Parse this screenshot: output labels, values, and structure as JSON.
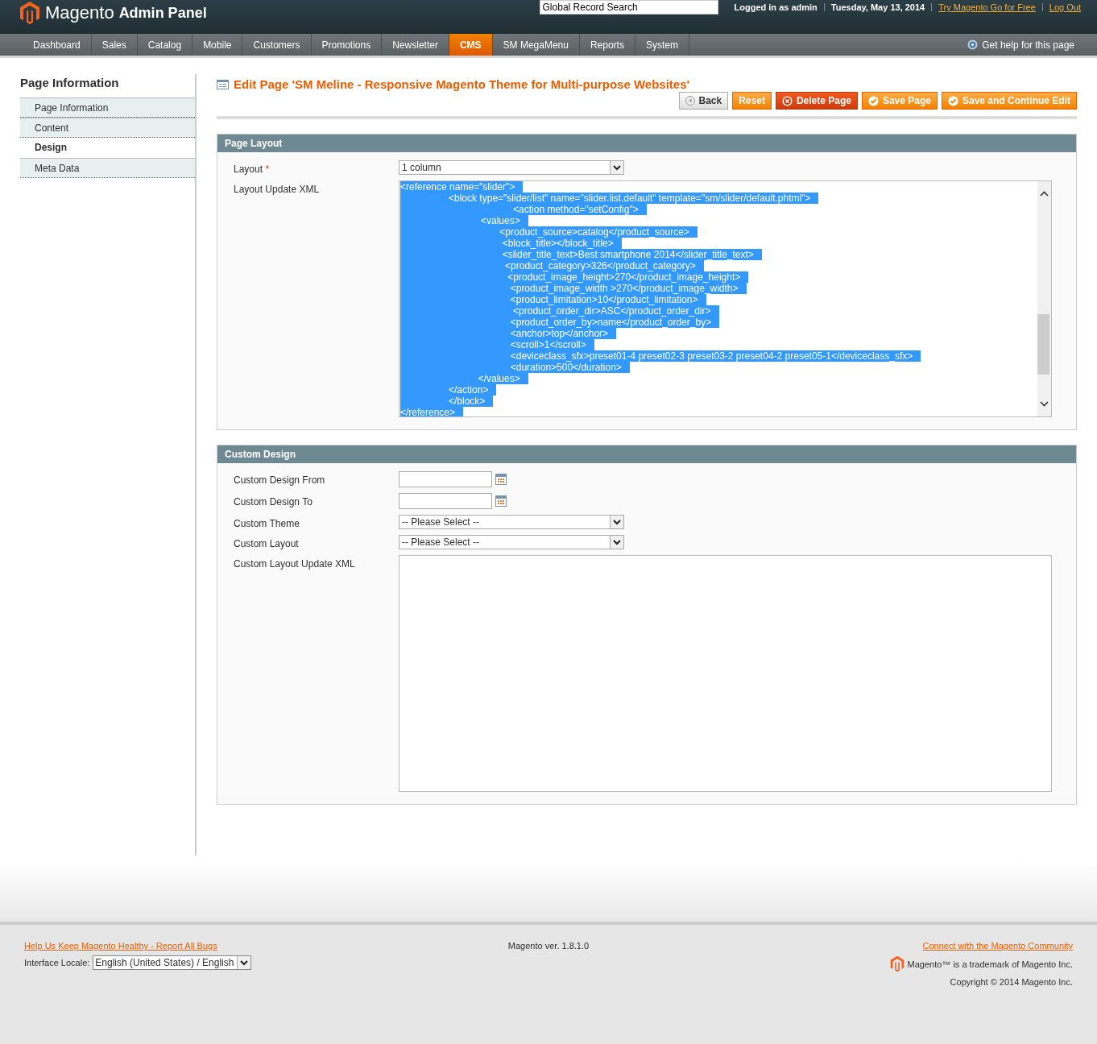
{
  "header": {
    "logo": "Magento",
    "logo_suffix": "Admin Panel",
    "search": {
      "value": "Global Record Search"
    },
    "user": "Logged in as admin",
    "date": "Tuesday, May 13, 2014",
    "links": [
      "Try Magento Go for Free",
      "Log Out"
    ]
  },
  "nav": {
    "items": [
      {
        "label": "Dashboard",
        "selected": false
      },
      {
        "label": "Sales",
        "selected": false
      },
      {
        "label": "Catalog",
        "selected": false
      },
      {
        "label": "Mobile",
        "selected": false
      },
      {
        "label": "Customers",
        "selected": false
      },
      {
        "label": "Promotions",
        "selected": false
      },
      {
        "label": "Newsletter",
        "selected": false
      },
      {
        "label": "CMS",
        "selected": true
      },
      {
        "label": "SM MegaMenu",
        "selected": false
      },
      {
        "label": "Reports",
        "selected": false
      },
      {
        "label": "System",
        "selected": false
      }
    ],
    "help": "Get help for this page"
  },
  "sidebar": {
    "title": "Page Information",
    "items": [
      {
        "label": "Page Information",
        "selected": false
      },
      {
        "label": "Content",
        "selected": false
      },
      {
        "label": "Design",
        "selected": true
      },
      {
        "label": "Meta Data",
        "selected": false
      }
    ]
  },
  "required_marker": "*",
  "page_title": "Edit Page 'SM Meline - Responsive Magento Theme for Multi-purpose Websites'",
  "buttons": [
    {
      "label": "Back",
      "kind": "back"
    },
    {
      "label": "Reset",
      "kind": "plain"
    },
    {
      "label": "Delete Page",
      "kind": "delete"
    },
    {
      "label": "Save Page",
      "kind": "save"
    },
    {
      "label": "Save and Continue Edit",
      "kind": "save"
    }
  ],
  "sections": [
    {
      "title": "Page Layout",
      "fields": [
        {
          "kind": "select",
          "label": "Layout",
          "required": true,
          "value": "1 column"
        },
        {
          "kind": "xml",
          "label": "Layout Update XML",
          "selected": true,
          "lines": [
            "<reference name=\"slider\">",
            "                  <block type=\"slider/list\" name=\"slider.list.default\" template=\"sm/slider/default.phtml\">",
            "                                          <action method=\"setConfig\">",
            "                              <values>",
            "                                     <product_source>catalog</product_source>",
            "                                      <block_title></block_title>",
            "                                      <slider_title_text>Best smartphone 2014</slider_title_text>",
            "                                       <product_category>326</product_category>",
            "                                        <product_image_height>270</product_image_height>",
            "                                         <product_image_width >270</product_image_width>",
            "                                         <product_limitation>10</product_limitation>",
            "                                          <product_order_dir>ASC</product_order_dir>",
            "                                         <product_order_by>name</product_order_by>",
            "                                         <anchor>top</anchor>",
            "                                         <scroll>1</scroll>",
            "                                         <deviceclass_sfx>preset01-4 preset02-3 preset03-2 preset04-2 preset05-1</deviceclass_sfx>",
            "                                         <duration>500</duration>",
            "                             </values>",
            "                  </action>",
            "                  </block>",
            "</reference>"
          ]
        }
      ]
    },
    {
      "title": "Custom Design",
      "fields": [
        {
          "kind": "date",
          "label": "Custom Design From"
        },
        {
          "kind": "date",
          "label": "Custom Design To"
        },
        {
          "kind": "select",
          "label": "Custom Theme",
          "required": false,
          "value": "-- Please Select --"
        },
        {
          "kind": "select",
          "label": "Custom Layout",
          "required": false,
          "value": "-- Please Select --"
        },
        {
          "kind": "textarea",
          "label": "Custom Layout Update XML"
        }
      ]
    }
  ],
  "footer": {
    "report_link": "Help Us Keep Magento Healthy - Report All Bugs",
    "locale_label": "Interface Locale:",
    "locale_value": "English (United States) / English",
    "version": "Magento ver. 1.8.1.0",
    "community_link": "Connect with the Magento Community",
    "trademark": "Magento™ is a trademark of Magento Inc.",
    "copyright": "Copyright © 2014 Magento Inc."
  }
}
